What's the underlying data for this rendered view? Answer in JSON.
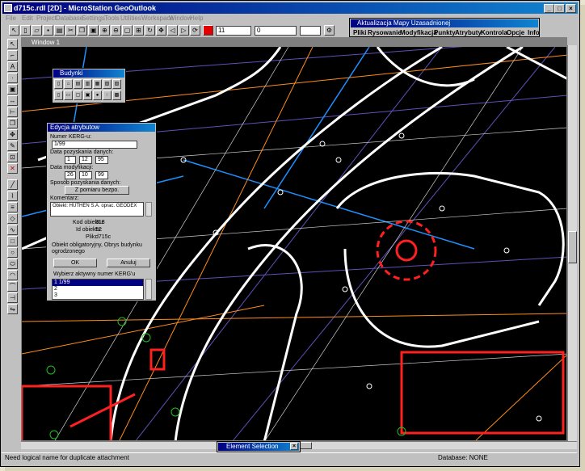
{
  "app": {
    "title": "d715c.rdl [2D] - MicroStation GeoOutlook"
  },
  "menu": [
    "File",
    "Edit",
    "Project",
    "Database",
    "Settings",
    "Tools",
    "Utilities",
    "Workspace",
    "Window",
    "Help"
  ],
  "toolbar": {
    "level_value": "11",
    "line_style_value": "0"
  },
  "aktualizacja": {
    "title": "Aktualizacja Mapy Uzasadnionej",
    "menu": [
      "Pliki",
      "Rysowanie",
      "Modyfikacja",
      "Punkty",
      "Atrybuty",
      "Kontrola",
      "Opcje",
      "Info"
    ]
  },
  "view": {
    "title": "Window 1"
  },
  "budynki": {
    "title": "Budynki"
  },
  "dialog": {
    "title": "Edycja atrybutow",
    "kerg_label": "Numer KERG-u:",
    "kerg_value": "1/99",
    "data_pozysk_label": "Data pozyskania danych:",
    "data_pozysk": [
      "1",
      "12",
      "95"
    ],
    "data_mod_label": "Data modyfikacji:",
    "data_mod": [
      "26",
      "10",
      "99"
    ],
    "sposob_label": "Sposób pozyskania danych:",
    "sposob_value": "Z pomiaru bezpo.",
    "komentarz_label": "Komentarz:",
    "komentarz_value": "Obiekt: HUTHEN S.A. oprac. GEODEX",
    "kod_label": "Kod obiektu:",
    "kod_value": "318",
    "id_label": "Id obiektu:",
    "id_value": "52",
    "plik_label": "Plik:",
    "plik_value": "d715c",
    "info_text": "Obiekt obligatoryjny, Obrys budynku ogrodzonego",
    "ok_label": "OK",
    "cancel_label": "Anuluj",
    "list_label": "Wybierz aktywny numer KERG'u",
    "list_items": [
      "1 1/99",
      "2",
      "3"
    ]
  },
  "element_selection": {
    "title": "Element Selection"
  },
  "status": {
    "message": "Need logical name for duplicate attachment",
    "database": "Database: NONE"
  },
  "colors": {
    "title_active": "#000080",
    "title_inactive": "#808080",
    "map_bg": "#000000",
    "lot_red": "#ff2020",
    "road_white": "#ffffff",
    "label_orange": "#ff8c1a"
  }
}
